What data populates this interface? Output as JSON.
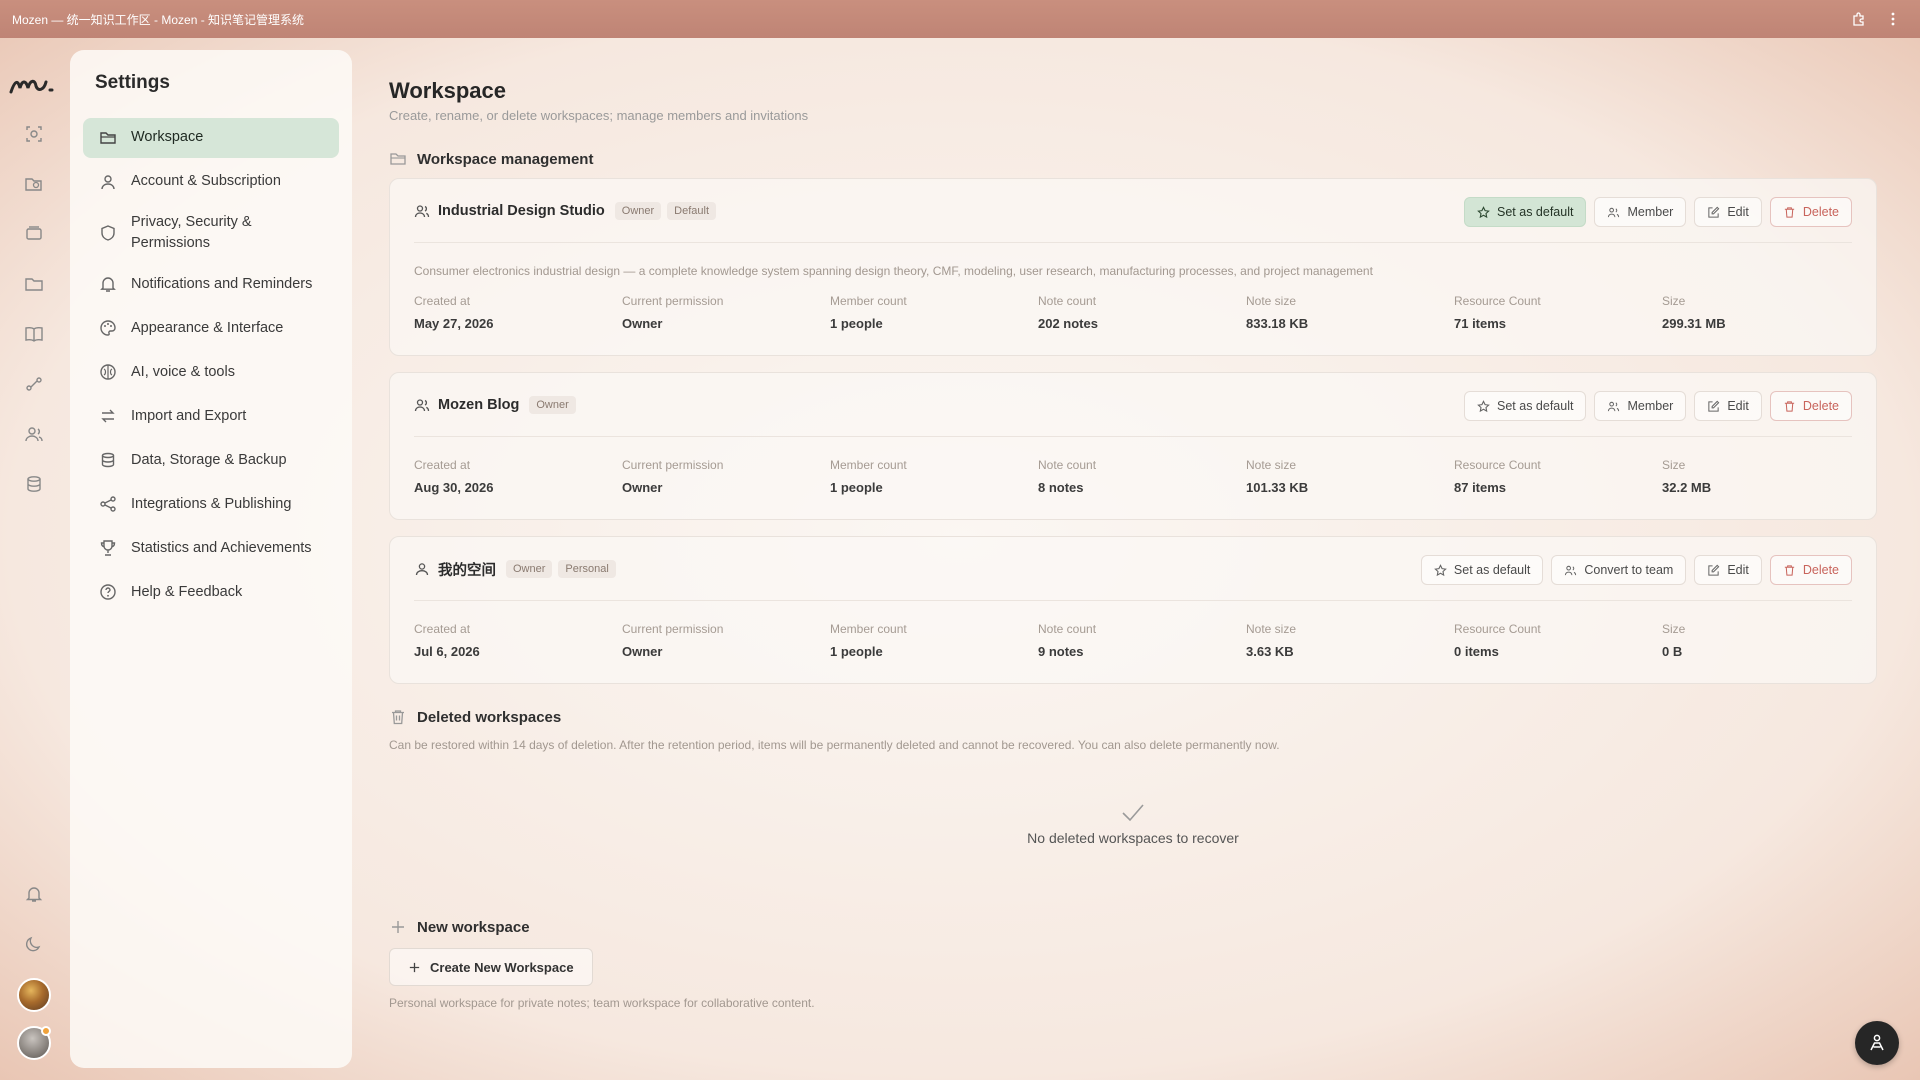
{
  "window": {
    "title": "Mozen — 统一知识工作区 - Mozen - 知识笔记管理系统"
  },
  "rail": {
    "icons": [
      "focus-icon",
      "search-folder-icon",
      "layers-icon",
      "folder-icon",
      "book-icon",
      "graph-icon",
      "users-icon",
      "database-icon"
    ],
    "bottom_icons": [
      "bell-icon",
      "moon-icon"
    ]
  },
  "settings": {
    "title": "Settings",
    "menu": [
      {
        "label": "Workspace",
        "icon": "folder-icon",
        "active": true
      },
      {
        "label": "Account & Subscription",
        "icon": "user-icon"
      },
      {
        "label": "Privacy, Security & Permissions",
        "icon": "shield-icon"
      },
      {
        "label": "Notifications and Reminders",
        "icon": "bell-icon"
      },
      {
        "label": "Appearance & Interface",
        "icon": "palette-icon"
      },
      {
        "label": "AI, voice & tools",
        "icon": "brain-icon"
      },
      {
        "label": "Import and Export",
        "icon": "swap-icon"
      },
      {
        "label": "Data, Storage & Backup",
        "icon": "database-icon"
      },
      {
        "label": "Integrations & Publishing",
        "icon": "share-icon"
      },
      {
        "label": "Statistics and Achievements",
        "icon": "trophy-icon"
      },
      {
        "label": "Help & Feedback",
        "icon": "help-icon"
      }
    ]
  },
  "main": {
    "title": "Workspace",
    "subtitle": "Create, rename, or delete workspaces; manage members and invitations",
    "management_heading": "Workspace management",
    "stat_labels": {
      "created": "Created at",
      "permission": "Current permission",
      "members": "Member count",
      "notes": "Note count",
      "note_size": "Note size",
      "resources": "Resource Count",
      "size": "Size"
    },
    "workspaces": [
      {
        "name": "Industrial Design Studio",
        "badges": [
          "Owner",
          "Default"
        ],
        "actions": [
          "Set as default",
          "Member",
          "Edit",
          "Delete"
        ],
        "description": "Consumer electronics industrial design — a complete knowledge system spanning design theory, CMF, modeling, user research, manufacturing processes, and project management",
        "created": "May 27, 2026",
        "permission": "Owner",
        "members": "1 people",
        "notes": "202 notes",
        "note_size": "833.18 KB",
        "resources": "71 items",
        "size": "299.31 MB"
      },
      {
        "name": "Mozen Blog",
        "badges": [
          "Owner"
        ],
        "actions": [
          "Set as default",
          "Member",
          "Edit",
          "Delete"
        ],
        "created": "Aug 30, 2026",
        "permission": "Owner",
        "members": "1 people",
        "notes": "8 notes",
        "note_size": "101.33 KB",
        "resources": "87 items",
        "size": "32.2 MB"
      },
      {
        "name": "我的空间",
        "badges": [
          "Owner",
          "Personal"
        ],
        "actions": [
          "Set as default",
          "Convert to team",
          "Edit",
          "Delete"
        ],
        "created": "Jul 6, 2026",
        "permission": "Owner",
        "members": "1 people",
        "notes": "9 notes",
        "note_size": "3.63 KB",
        "resources": "0 items",
        "size": "0 B"
      }
    ],
    "deleted": {
      "heading": "Deleted workspaces",
      "note": "Can be restored within 14 days of deletion. After the retention period, items will be permanently deleted and cannot be recovered. You can also delete permanently now.",
      "empty_message": "No deleted workspaces to recover"
    },
    "new_ws": {
      "heading": "New workspace",
      "button": "Create New Workspace",
      "note": "Personal workspace for private notes; team workspace for collaborative content."
    }
  },
  "colors": {
    "accent_green": "#d3e5d5",
    "danger": "#c8645c",
    "titlebar": "#c98f7e"
  }
}
